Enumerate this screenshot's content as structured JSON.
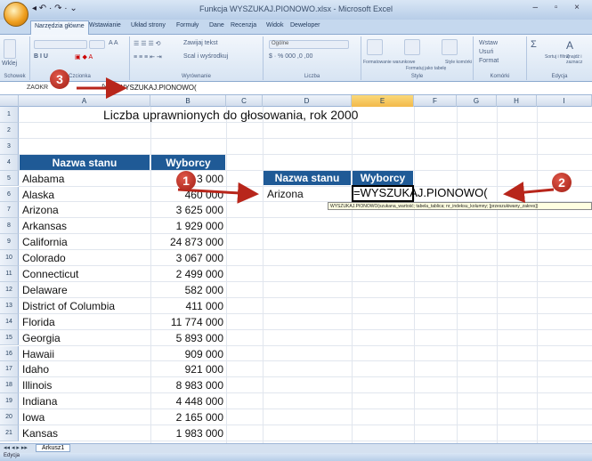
{
  "window": {
    "title": "Funkcja WYSZUKAJ.PIONOWO.xlsx - Microsoft Excel",
    "controls": "– ▫ ×"
  },
  "quick_access": "◂ ↶ · ↷ · ⌄",
  "tabs": [
    "Narzędzia główne",
    "Wstawianie",
    "Układ strony",
    "Formuły",
    "Dane",
    "Recenzja",
    "Widok",
    "Deweloper"
  ],
  "ribbon": {
    "groups": [
      "Schowek",
      "Czcionka",
      "Wyrównanie",
      "Liczba",
      "Style",
      "Komórki",
      "Edycja"
    ],
    "paste_label": "Wklej",
    "number_format": "Ogólne",
    "wrap_text": "Zawijaj tekst",
    "merge": "Scal i wyśrodkuj",
    "cond_format": "Formatowanie warunkowe",
    "format_table": "Formatuj jako tabelę",
    "cell_styles": "Style komórki",
    "insert": "Wstaw",
    "delete": "Usuń",
    "format": "Format",
    "sort": "Sortuj i filtruj",
    "find": "Znajdź i zaznacz"
  },
  "formula_bar": {
    "name_box": "ZAOKR",
    "fx": "fx",
    "formula": "=WYSZUKAJ.PIONOWO("
  },
  "columns": [
    "A",
    "B",
    "C",
    "D",
    "E",
    "F",
    "G",
    "H",
    "I"
  ],
  "row_numbers": [
    "1",
    "2",
    "3",
    "4",
    "5",
    "6",
    "7",
    "8",
    "9",
    "10",
    "11",
    "12",
    "13",
    "14",
    "15",
    "16",
    "17",
    "18",
    "19",
    "20",
    "21"
  ],
  "sheet_title": "Liczba uprawnionych do głosowania, rok 2000",
  "table_headers": {
    "state": "Nazwa stanu",
    "voters": "Wyborcy"
  },
  "states": [
    {
      "name": "Alabama",
      "voters": "3 3   000"
    },
    {
      "name": "Alaska",
      "voters": "460 000"
    },
    {
      "name": "Arizona",
      "voters": "3 625 000"
    },
    {
      "name": "Arkansas",
      "voters": "1 929 000"
    },
    {
      "name": "California",
      "voters": "24 873 000"
    },
    {
      "name": "Colorado",
      "voters": "3 067 000"
    },
    {
      "name": "Connecticut",
      "voters": "2 499 000"
    },
    {
      "name": "Delaware",
      "voters": "582 000"
    },
    {
      "name": "District of Columbia",
      "voters": "411 000"
    },
    {
      "name": "Florida",
      "voters": "11 774 000"
    },
    {
      "name": "Georgia",
      "voters": "5 893 000"
    },
    {
      "name": "Hawaii",
      "voters": "909 000"
    },
    {
      "name": "Idaho",
      "voters": "921 000"
    },
    {
      "name": "Illinois",
      "voters": "8 983 000"
    },
    {
      "name": "Indiana",
      "voters": "4 448 000"
    },
    {
      "name": "Iowa",
      "voters": "2 165 000"
    },
    {
      "name": "Kansas",
      "voters": "1 983 000"
    }
  ],
  "lookup": {
    "header_state": "Nazwa stanu",
    "header_voters": "Wyborcy",
    "state": "Arizona",
    "formula": "=WYSZUKAJ.PIONOWO("
  },
  "tooltip": "WYSZUKAJ.PIONOWO(szukana_wartość; tabela_tablica; nr_indeksu_kolumny; [przeszukiwany_zakres])",
  "sheet_tab": "Arkusz1",
  "status": "Edycja",
  "callouts": [
    "1",
    "2",
    "3"
  ],
  "colors": {
    "header_blue": "#1f5a96",
    "callout_red": "#b8261b",
    "selected_col": "#f2b94a"
  }
}
